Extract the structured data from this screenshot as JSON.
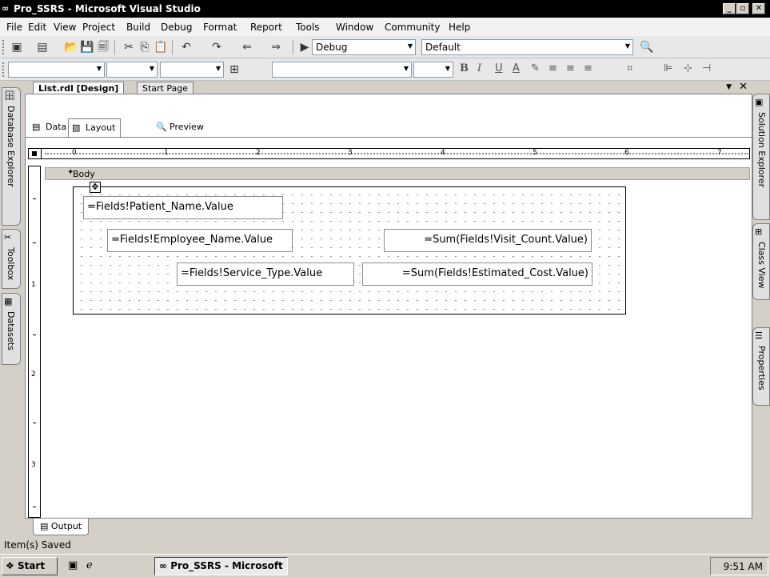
{
  "window": {
    "title": "Pro_SSRS - Microsoft Visual Studio"
  },
  "menu": [
    "File",
    "Edit",
    "View",
    "Project",
    "Build",
    "Debug",
    "Format",
    "Report",
    "Tools",
    "Window",
    "Community",
    "Help"
  ],
  "toolbar": {
    "config": "Debug",
    "platform": "Default"
  },
  "doc_tabs": {
    "active": "List.rdl [Design]",
    "other": "Start Page"
  },
  "view_tabs": {
    "data": "Data",
    "layout": "Layout",
    "preview": "Preview"
  },
  "ruler": {
    "h": [
      "0",
      "1",
      "2",
      "3",
      "4",
      "5",
      "6",
      "7"
    ],
    "v": [
      "1",
      "2",
      "3"
    ]
  },
  "body_section": "Body",
  "fields": {
    "patient": "=Fields!Patient_Name.Value",
    "employee": "=Fields!Employee_Name.Value",
    "visit_count": "=Sum(Fields!Visit_Count.Value)",
    "service": "=Fields!Service_Type.Value",
    "estimated_cost": "=Sum(Fields!Estimated_Cost.Value)"
  },
  "side_left": [
    "Database Explorer",
    "Toolbox",
    "Datasets"
  ],
  "side_right": [
    "Solution Explorer",
    "Class View",
    "Properties"
  ],
  "output_tab": "Output",
  "status": "Item(s) Saved",
  "taskbar": {
    "start": "Start",
    "task": "Pro_SSRS - Microsoft ...",
    "clock": "9:51 AM"
  }
}
